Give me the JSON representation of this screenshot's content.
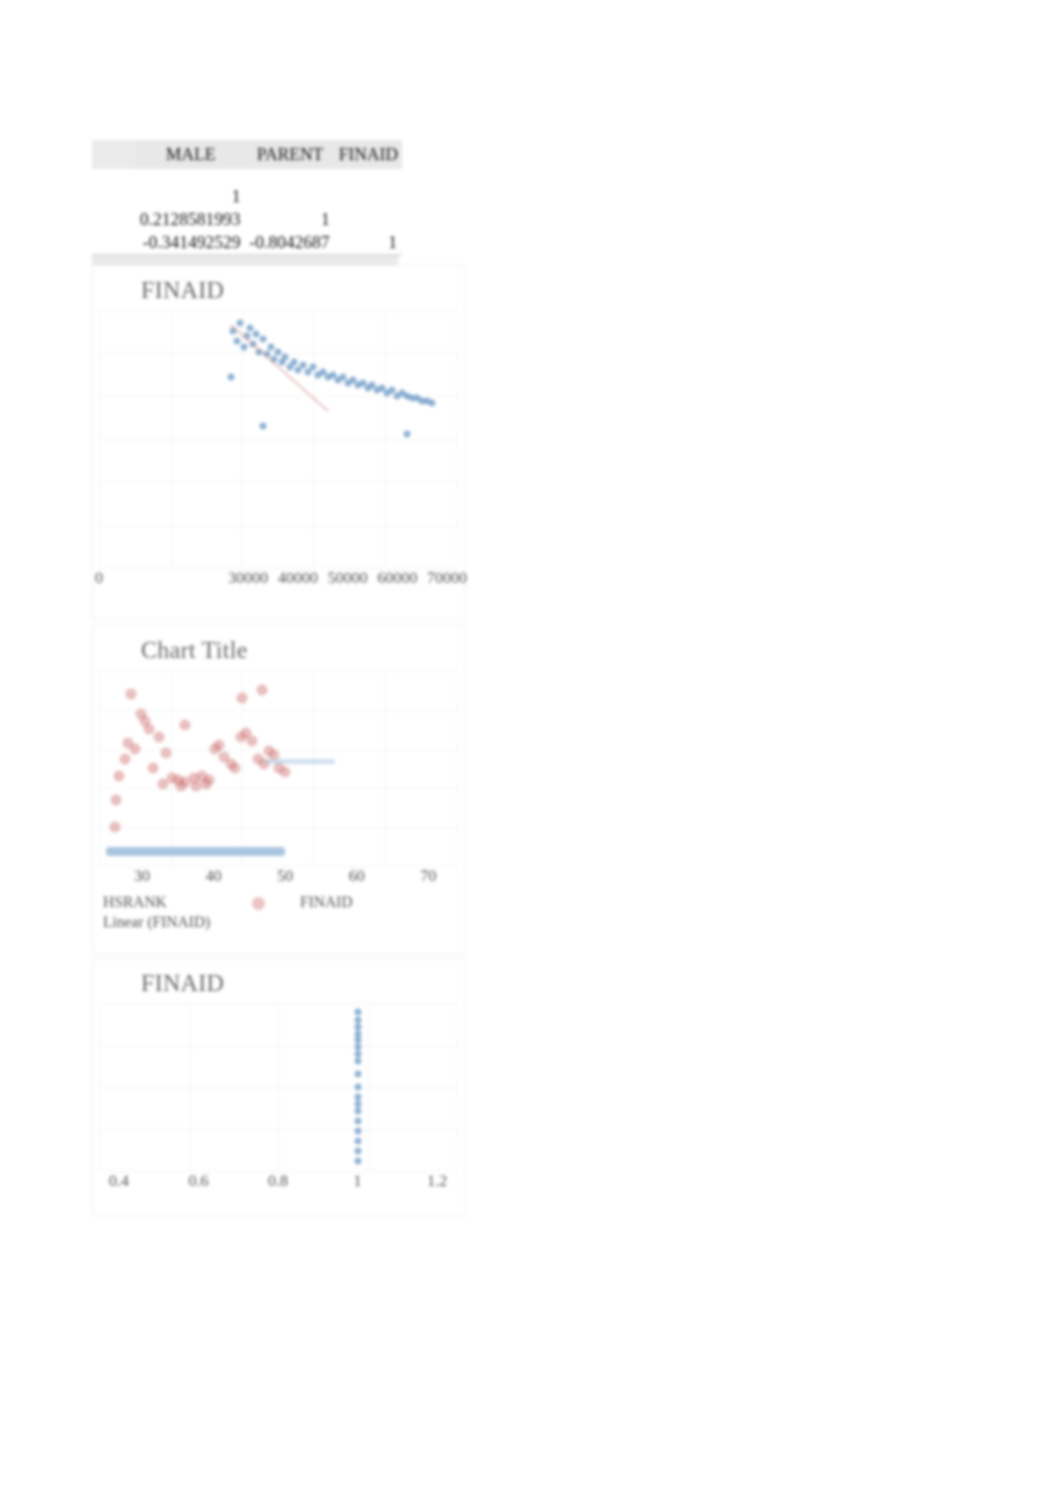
{
  "document": {
    "kind": "spreadsheet-correlation-output"
  },
  "corr_table": {
    "name": "correlation-matrix",
    "blank_corner": "",
    "columns": [
      "MALE",
      "PARENT",
      "FINAID"
    ],
    "rows": [
      {
        "label": "",
        "cells": [
          "1",
          "",
          ""
        ]
      },
      {
        "label": "",
        "cells": [
          "0.2128581993",
          "1",
          ""
        ]
      },
      {
        "label": "",
        "cells": [
          "-0.341492529",
          "-0.8042687",
          "1"
        ]
      }
    ]
  },
  "charts": [
    {
      "title": "FINAID",
      "xticks": [
        "0",
        "30000",
        "40000",
        "50000",
        "60000",
        "70000"
      ],
      "legend": []
    },
    {
      "title": "Chart Title",
      "xticks": [
        "30",
        "40",
        "50",
        "60",
        "70"
      ],
      "legend": [
        "HSRANK",
        "FINAID",
        "Linear (FINAID)"
      ]
    },
    {
      "title": "FINAID",
      "xticks": [
        "0.4",
        "0.6",
        "0.8",
        "1",
        "1.2"
      ],
      "legend": []
    }
  ],
  "colors": {
    "series_blue": "#5b8ebe",
    "series_red": "#c55a5a",
    "title_grey": "#595959",
    "gridline": "#f2f4f5",
    "header_fill": "#e6e6e6"
  },
  "chart_data": [
    {
      "type": "scatter",
      "title": "FINAID",
      "xlabel": "",
      "ylabel": "",
      "xlim": [
        0,
        72000
      ],
      "ylim": [
        0,
        1
      ],
      "grid": true,
      "legend_position": "none",
      "xticks": [
        0,
        30000,
        40000,
        50000,
        60000,
        70000
      ],
      "series": [
        {
          "name": "FINAID",
          "color": "#5b8ebe",
          "points": [
            [
              27000,
              0.92
            ],
            [
              27800,
              0.88
            ],
            [
              28400,
              0.95
            ],
            [
              29100,
              0.86
            ],
            [
              29800,
              0.9
            ],
            [
              30300,
              0.93
            ],
            [
              31000,
              0.87
            ],
            [
              31600,
              0.91
            ],
            [
              32200,
              0.84
            ],
            [
              33000,
              0.89
            ],
            [
              33800,
              0.83
            ],
            [
              34500,
              0.86
            ],
            [
              35200,
              0.81
            ],
            [
              36000,
              0.84
            ],
            [
              36800,
              0.8
            ],
            [
              37500,
              0.82
            ],
            [
              38400,
              0.78
            ],
            [
              39200,
              0.8
            ],
            [
              40000,
              0.77
            ],
            [
              41000,
              0.79
            ],
            [
              42000,
              0.76
            ],
            [
              43000,
              0.78
            ],
            [
              44000,
              0.75
            ],
            [
              45000,
              0.76
            ],
            [
              46000,
              0.74
            ],
            [
              47000,
              0.75
            ],
            [
              48000,
              0.73
            ],
            [
              49000,
              0.74
            ],
            [
              50000,
              0.72
            ],
            [
              51000,
              0.73
            ],
            [
              52000,
              0.71
            ],
            [
              53000,
              0.72
            ],
            [
              54000,
              0.7
            ],
            [
              55000,
              0.71
            ],
            [
              56000,
              0.69
            ],
            [
              57000,
              0.7
            ],
            [
              58000,
              0.68
            ],
            [
              59000,
              0.69
            ],
            [
              60000,
              0.67
            ],
            [
              61000,
              0.68
            ],
            [
              62000,
              0.67
            ],
            [
              63000,
              0.66
            ],
            [
              64000,
              0.66
            ],
            [
              65000,
              0.65
            ],
            [
              66000,
              0.65
            ],
            [
              67000,
              0.64
            ],
            [
              26500,
              0.74
            ],
            [
              33000,
              0.55
            ],
            [
              62000,
              0.52
            ]
          ]
        },
        {
          "name": "Linear (FINAID)",
          "color": "#c55a5a",
          "trend": {
            "x0": 26500,
            "y0": 0.93,
            "x1": 46000,
            "y1": 0.5
          }
        }
      ]
    },
    {
      "type": "scatter",
      "title": "Chart Title",
      "xlabel": "",
      "ylabel": "",
      "xlim": [
        24,
        74
      ],
      "ylim": [
        0,
        1
      ],
      "grid": true,
      "legend_position": "bottom",
      "xticks": [
        30,
        40,
        50,
        60,
        70
      ],
      "series": [
        {
          "name": "FINAID",
          "color": "#c55a5a",
          "points": [
            [
              28.5,
              0.88
            ],
            [
              29.8,
              0.78
            ],
            [
              30.4,
              0.74
            ],
            [
              31.0,
              0.7
            ],
            [
              28.0,
              0.63
            ],
            [
              29.0,
              0.6
            ],
            [
              27.6,
              0.55
            ],
            [
              26.8,
              0.46
            ],
            [
              26.4,
              0.34
            ],
            [
              26.2,
              0.2
            ],
            [
              32.4,
              0.66
            ],
            [
              33.4,
              0.58
            ],
            [
              34.2,
              0.45
            ],
            [
              35.0,
              0.44
            ],
            [
              36.0,
              0.43
            ],
            [
              37.2,
              0.45
            ],
            [
              38.4,
              0.46
            ],
            [
              39.4,
              0.44
            ],
            [
              40.2,
              0.6
            ],
            [
              40.8,
              0.62
            ],
            [
              41.5,
              0.56
            ],
            [
              42.4,
              0.52
            ],
            [
              43.0,
              0.5
            ],
            [
              43.8,
              0.66
            ],
            [
              44.6,
              0.68
            ],
            [
              45.4,
              0.64
            ],
            [
              46.2,
              0.55
            ],
            [
              47.0,
              0.52
            ],
            [
              47.8,
              0.59
            ],
            [
              48.4,
              0.57
            ],
            [
              49.2,
              0.5
            ],
            [
              50.0,
              0.48
            ],
            [
              44.0,
              0.86
            ],
            [
              46.8,
              0.9
            ],
            [
              36.0,
              0.72
            ],
            [
              31.5,
              0.5
            ],
            [
              33.0,
              0.42
            ],
            [
              35.4,
              0.41
            ],
            [
              37.6,
              0.41
            ],
            [
              39.0,
              0.42
            ]
          ]
        },
        {
          "name": "HSRANK",
          "color": "#8db2d5",
          "band": {
            "x0": 25,
            "x1": 50,
            "y": 0.1
          },
          "segment": {
            "x0": 47,
            "x1": 57,
            "y": 0.55
          }
        }
      ]
    },
    {
      "type": "scatter",
      "title": "FINAID",
      "xlabel": "",
      "ylabel": "",
      "xlim": [
        0.35,
        1.25
      ],
      "ylim": [
        0,
        1
      ],
      "grid": true,
      "legend_position": "none",
      "xticks": [
        0.4,
        0.6,
        0.8,
        1.0,
        1.2
      ],
      "series": [
        {
          "name": "FINAID",
          "color": "#5b8ebe",
          "points": [
            [
              1.0,
              0.95
            ],
            [
              1.0,
              0.9
            ],
            [
              1.0,
              0.86
            ],
            [
              1.0,
              0.82
            ],
            [
              1.0,
              0.78
            ],
            [
              1.0,
              0.74
            ],
            [
              1.0,
              0.7
            ],
            [
              1.0,
              0.66
            ],
            [
              1.0,
              0.58
            ],
            [
              1.0,
              0.5
            ],
            [
              1.0,
              0.44
            ],
            [
              1.0,
              0.4
            ],
            [
              1.0,
              0.36
            ],
            [
              1.0,
              0.3
            ],
            [
              1.0,
              0.24
            ],
            [
              1.0,
              0.18
            ],
            [
              1.0,
              0.12
            ],
            [
              1.0,
              0.06
            ]
          ]
        }
      ]
    }
  ]
}
